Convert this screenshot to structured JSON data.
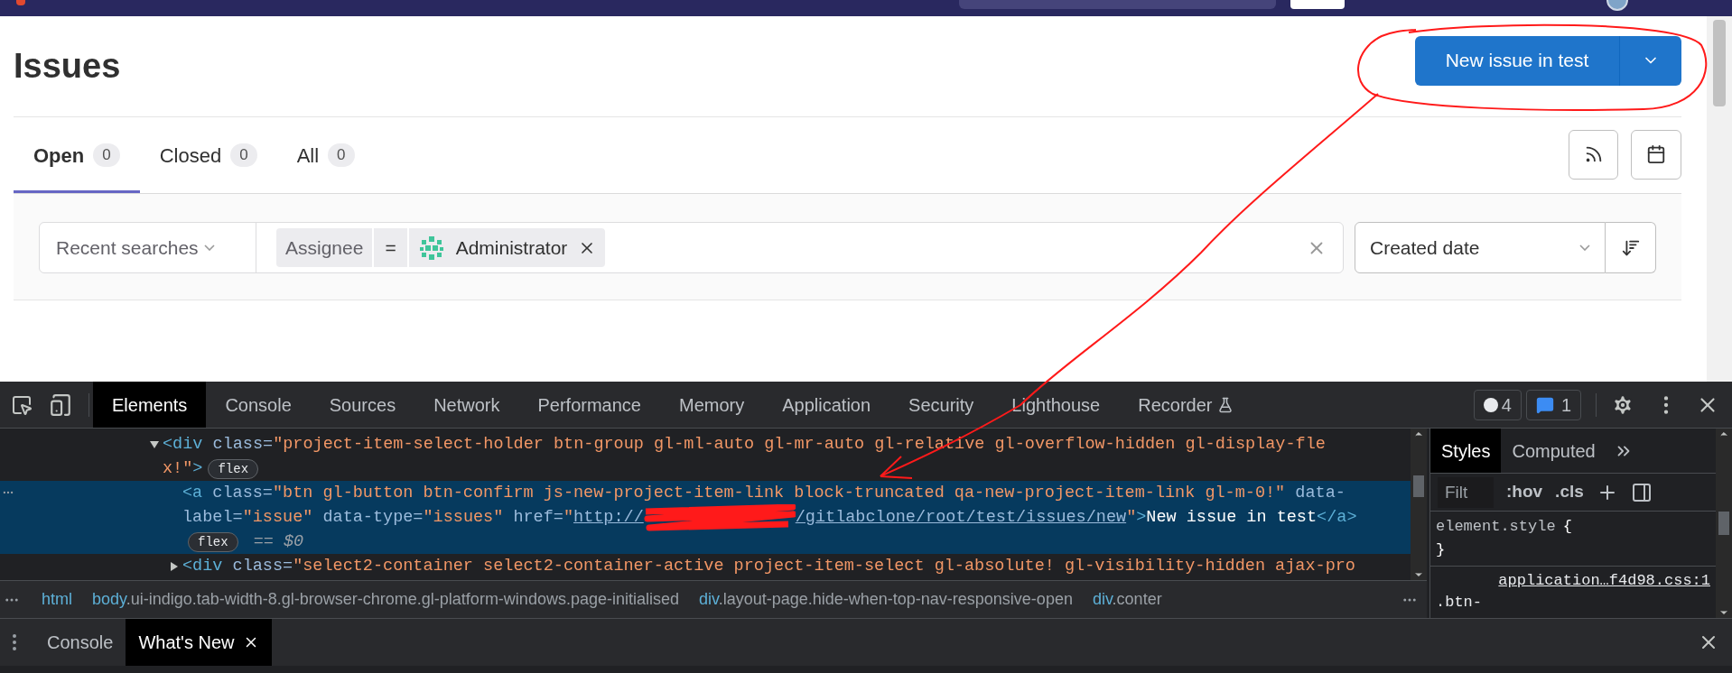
{
  "page": {
    "title": "Issues",
    "new_button": "New issue in test",
    "tabs": [
      {
        "label": "Open",
        "count": "0",
        "selected": true
      },
      {
        "label": "Closed",
        "count": "0",
        "selected": false
      },
      {
        "label": "All",
        "count": "0",
        "selected": false
      }
    ],
    "filter": {
      "recent": "Recent searches",
      "token": {
        "name": "Assignee",
        "operator": "=",
        "value": "Administrator"
      }
    },
    "sort": {
      "label": "Created date"
    }
  },
  "devtools": {
    "tabs": [
      {
        "label": "Elements",
        "selected": true
      },
      {
        "label": "Console",
        "selected": false
      },
      {
        "label": "Sources",
        "selected": false
      },
      {
        "label": "Network",
        "selected": false
      },
      {
        "label": "Performance",
        "selected": false
      },
      {
        "label": "Memory",
        "selected": false
      },
      {
        "label": "Application",
        "selected": false
      },
      {
        "label": "Security",
        "selected": false
      },
      {
        "label": "Lighthouse",
        "selected": false
      },
      {
        "label": "Recorder",
        "selected": false
      }
    ],
    "issues_count": "4",
    "messages_count": "1",
    "dom_tree": [
      {
        "expanded": true,
        "selected": false,
        "lines": [
          [
            {
              "kind": "tag",
              "t": "<div"
            },
            {
              "kind": "attr",
              "t": " class="
            },
            {
              "kind": "value",
              "t": "\"project-item-select-holder btn-group gl-ml-auto gl-mr-auto gl-relative gl-overflow-hidden gl-display-fle"
            }
          ],
          [
            {
              "kind": "value",
              "t": "x!\""
            },
            {
              "kind": "tag",
              "t": ">"
            },
            {
              "kind": "badge",
              "t": "flex"
            }
          ]
        ],
        "children": [
          {
            "selected": true,
            "lines": [
              [
                {
                  "kind": "tag",
                  "t": "<a"
                },
                {
                  "kind": "attr",
                  "t": " class="
                },
                {
                  "kind": "value",
                  "t": "\"btn gl-button btn-confirm js-new-project-item-link block-truncated qa-new-project-item-link gl-m-0!\""
                },
                {
                  "kind": "attr",
                  "t": " data-"
                }
              ],
              [
                {
                  "kind": "attr",
                  "t": "label="
                },
                {
                  "kind": "value",
                  "t": "\"issue\""
                },
                {
                  "kind": "attr",
                  "t": " data-type="
                },
                {
                  "kind": "value",
                  "t": "\"issues\""
                },
                {
                  "kind": "attr",
                  "t": " href="
                },
                {
                  "kind": "value",
                  "t": "\""
                },
                {
                  "kind": "link",
                  "t": "http://"
                },
                {
                  "kind": "redaction"
                },
                {
                  "kind": "link",
                  "t": "/gitlabclone/root/test/issues/new"
                },
                {
                  "kind": "value",
                  "t": "\""
                },
                {
                  "kind": "tag",
                  "t": ">"
                },
                {
                  "kind": "text",
                  "t": "New issue in test"
                },
                {
                  "kind": "tag",
                  "t": "</a>"
                }
              ],
              [
                {
                  "kind": "badge",
                  "t": "flex"
                },
                {
                  "kind": "marker",
                  "t": " == $0"
                }
              ]
            ]
          },
          {
            "expanded": false,
            "selected": false,
            "lines": [
              [
                {
                  "kind": "tag",
                  "t": "<div"
                },
                {
                  "kind": "attr",
                  "t": " class="
                },
                {
                  "kind": "value",
                  "t": "\"select2-container select2-container-active project-item-select gl-absolute! gl-visibility-hidden ajax-pro"
                }
              ]
            ]
          }
        ]
      }
    ],
    "breadcrumbs": [
      {
        "tag": "html"
      },
      {
        "tag": "body",
        "classes": ".ui-indigo.tab-width-8.gl-browser-chrome.gl-platform-windows.page-initialised"
      },
      {
        "tag": "div",
        "classes": ".layout-page.hide-when-top-nav-responsive-open"
      },
      {
        "tag": "div",
        "classes": ".conter"
      }
    ],
    "styles": {
      "tabs": [
        {
          "label": "Styles",
          "selected": true
        },
        {
          "label": "Computed",
          "selected": false
        }
      ],
      "filter_placeholder": "Filt",
      "toggles": [
        ":hov",
        ".cls"
      ],
      "selector": "element.style",
      "brace_open": "{",
      "brace_close": "}",
      "source_link": "application…f4d98.css:1",
      "next_selector": ".btn-"
    },
    "drawer": {
      "tabs": [
        {
          "label": "Console",
          "selected": false,
          "closable": false
        },
        {
          "label": "What's New",
          "selected": true,
          "closable": true
        }
      ]
    }
  }
}
